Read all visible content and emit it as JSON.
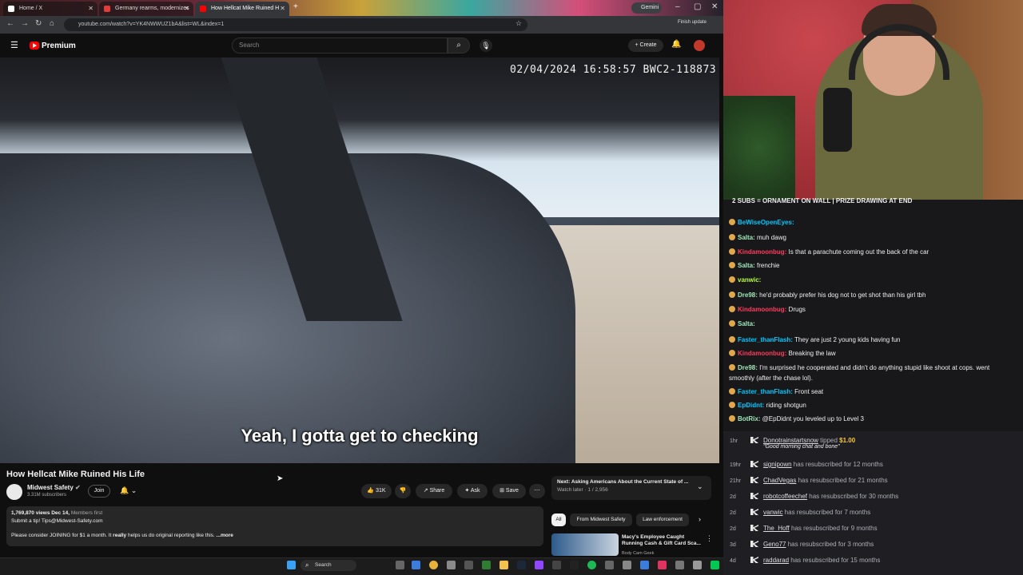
{
  "browser": {
    "tabs": [
      {
        "label": "Home / X"
      },
      {
        "label": "Germany rearms, modernizes"
      },
      {
        "label": "How Hellcat Mike Ruined H"
      }
    ],
    "url": "youtube.com/watch?v=YK4NWWUZ1bA&list=WL&index=1",
    "gemini_label": "Gemini",
    "finish_update": "Finish update"
  },
  "youtube": {
    "brand": "Premium",
    "search_placeholder": "Search",
    "create_label": "Create"
  },
  "video": {
    "timestamp": "02/04/2024 16:58:57 BWC2-118873",
    "caption": "Yeah, I gotta get to checking",
    "title": "How Hellcat Mike Ruined His Life",
    "channel": "Midwest Safety",
    "subscribers": "3.31M subscribers",
    "join_label": "Join",
    "likes": "31K",
    "share_label": "Share",
    "ask_label": "Ask",
    "save_label": "Save",
    "views_date": "1,769,870 views  Dec 14,",
    "members_first": "Members first",
    "desc_line1": "Submit a tip! Tips@Midwest-Safety.com",
    "desc_line2a": "Please consider JOINING for $1 a month. It ",
    "desc_bold": "really",
    "desc_line2b": " helps us do original reporting like this.",
    "more": "...more"
  },
  "sidebar": {
    "next_label": "Next: Asking Americans About the Current State of ...",
    "next_sub": "Watch later · 1 / 2,956",
    "chips": [
      "All",
      "From Midwest Safety",
      "Law enforcement"
    ],
    "rec_title": "Macy's Employee Caught Running Cash & Gift Card Sca...",
    "rec_channel": "Body Cam Geek"
  },
  "taskbar": {
    "search_label": "Search"
  },
  "chat": {
    "banner": "2 SUBS = ORNAMENT ON WALL | PRIZE DRAWING AT END",
    "messages": [
      {
        "user": "BeWiseOpenEyes:",
        "text": "",
        "color": "#00c8ff"
      },
      {
        "user": "Salta:",
        "text": " muh dawg",
        "color": "#9fe6b8"
      },
      {
        "user": "Kindamoonbug:",
        "text": " Is that a parachute coming out the back of the car",
        "color": "#ff3b5c"
      },
      {
        "user": "Salta:",
        "text": " frenchie",
        "color": "#9fe6b8"
      },
      {
        "user": "vanwic:",
        "text": "",
        "color": "#b6ff3a"
      },
      {
        "user": "Dre98:",
        "text": " he'd probably prefer his dog not to get shot than his girl tbh",
        "color": "#9fe6b8"
      },
      {
        "user": "Kindamoonbug:",
        "text": " Drugs",
        "color": "#ff3b5c"
      },
      {
        "user": "Salta:",
        "text": "",
        "color": "#9fe6b8"
      },
      {
        "user": "Faster_thanFlash:",
        "text": " They are just 2 young kids having fun",
        "color": "#00c8ff"
      },
      {
        "user": "Kindamoonbug:",
        "text": " Breaking the law",
        "color": "#ff3b5c"
      },
      {
        "user": "Dre98:",
        "text": " I'm surprised he cooperated and didn't do anything stupid like shoot at cops. went",
        "color": "#9fe6b8"
      },
      {
        "user": "",
        "text": "smoothly (after the chase lol).",
        "color": "#9fe6b8"
      },
      {
        "user": "Faster_thanFlash:",
        "text": " Front seat",
        "color": "#00c8ff"
      },
      {
        "user": "EpDidnt:",
        "text": " riding shotgun",
        "color": "#00c8ff"
      },
      {
        "user": "BotRix:",
        "text": " @EpDidnt you leveled up to Level 3",
        "color": "#9fe6b8"
      }
    ]
  },
  "events": [
    {
      "age": "1hr",
      "user": "Donotrainstartsnow",
      "text": " tipped ",
      "amount": "$1.00",
      "note": "\"Good morning chat and bone\""
    },
    {
      "age": "19hr",
      "user": "signipown",
      "text": " has resubscribed for 12 months"
    },
    {
      "age": "21hr",
      "user": "ChadVegas",
      "text": " has resubscribed for 21 months"
    },
    {
      "age": "2d",
      "user": "robotcoffeechef",
      "text": " has resubscribed for 30 months"
    },
    {
      "age": "2d",
      "user": "vanwic",
      "text": " has resubscribed for 7 months"
    },
    {
      "age": "2d",
      "user": "The_Hoff",
      "text": " has resubscribed for 9 months"
    },
    {
      "age": "3d",
      "user": "Geno77",
      "text": " has resubscribed for 3 months"
    },
    {
      "age": "4d",
      "user": "raddarad",
      "text": " has resubscribed for 15 months"
    }
  ]
}
